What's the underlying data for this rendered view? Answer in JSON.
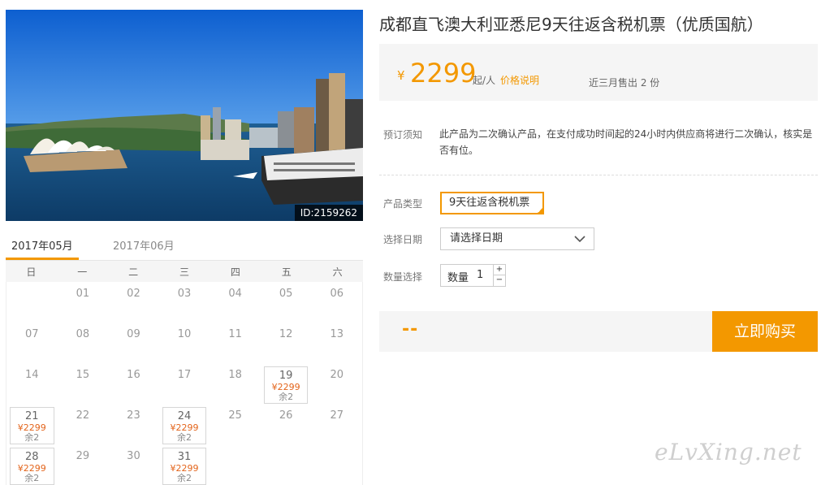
{
  "hero": {
    "image_id": "ID:2159262"
  },
  "calendar": {
    "months": [
      "2017年05月",
      "2017年06月"
    ],
    "weekdays": [
      "日",
      "一",
      "二",
      "三",
      "四",
      "五",
      "六"
    ],
    "weeks": [
      [
        {
          "day": ""
        },
        {
          "day": "01"
        },
        {
          "day": "02"
        },
        {
          "day": "03"
        },
        {
          "day": "04"
        },
        {
          "day": "05"
        },
        {
          "day": "06"
        }
      ],
      [
        {
          "day": "07"
        },
        {
          "day": "08"
        },
        {
          "day": "09"
        },
        {
          "day": "10"
        },
        {
          "day": "11"
        },
        {
          "day": "12"
        },
        {
          "day": "13"
        }
      ],
      [
        {
          "day": "14"
        },
        {
          "day": "15"
        },
        {
          "day": "16"
        },
        {
          "day": "17"
        },
        {
          "day": "18"
        },
        {
          "day": "19",
          "price": "¥2299",
          "stock": "余2"
        },
        {
          "day": "20"
        }
      ],
      [
        {
          "day": "21",
          "price": "¥2299",
          "stock": "余2"
        },
        {
          "day": "22"
        },
        {
          "day": "23"
        },
        {
          "day": "24",
          "price": "¥2299",
          "stock": "余2"
        },
        {
          "day": "25"
        },
        {
          "day": "26"
        },
        {
          "day": "27"
        }
      ],
      [
        {
          "day": "28",
          "price": "¥2299",
          "stock": "余2"
        },
        {
          "day": "29"
        },
        {
          "day": "30"
        },
        {
          "day": "31",
          "price": "¥2299",
          "stock": "余2"
        },
        {
          "day": ""
        },
        {
          "day": ""
        },
        {
          "day": ""
        }
      ]
    ]
  },
  "product": {
    "title": "成都直飞澳大利亚悉尼9天往返含税机票（优质国航）",
    "currency": "¥",
    "price": "2299",
    "per_person": "起/人",
    "price_note": "价格说明",
    "sold": "近三月售出 2 份"
  },
  "notice": {
    "label": "预订须知",
    "text": "此产品为二次确认产品，在支付成功时间起的24小时内供应商将进行二次确认，核实是否有位。"
  },
  "options": {
    "type_label": "产品类型",
    "type_value": "9天往返含税机票",
    "date_label": "选择日期",
    "date_placeholder": "请选择日期",
    "qty_label": "数量选择",
    "qty_inner_label": "数量",
    "qty_value": "1",
    "qty_plus": "+",
    "qty_minus": "−"
  },
  "buy": {
    "total": "--",
    "button": "立即购买"
  },
  "watermark": "eLvXing.net",
  "colors": {
    "accent": "#f39800",
    "price_small": "#e3641b"
  }
}
